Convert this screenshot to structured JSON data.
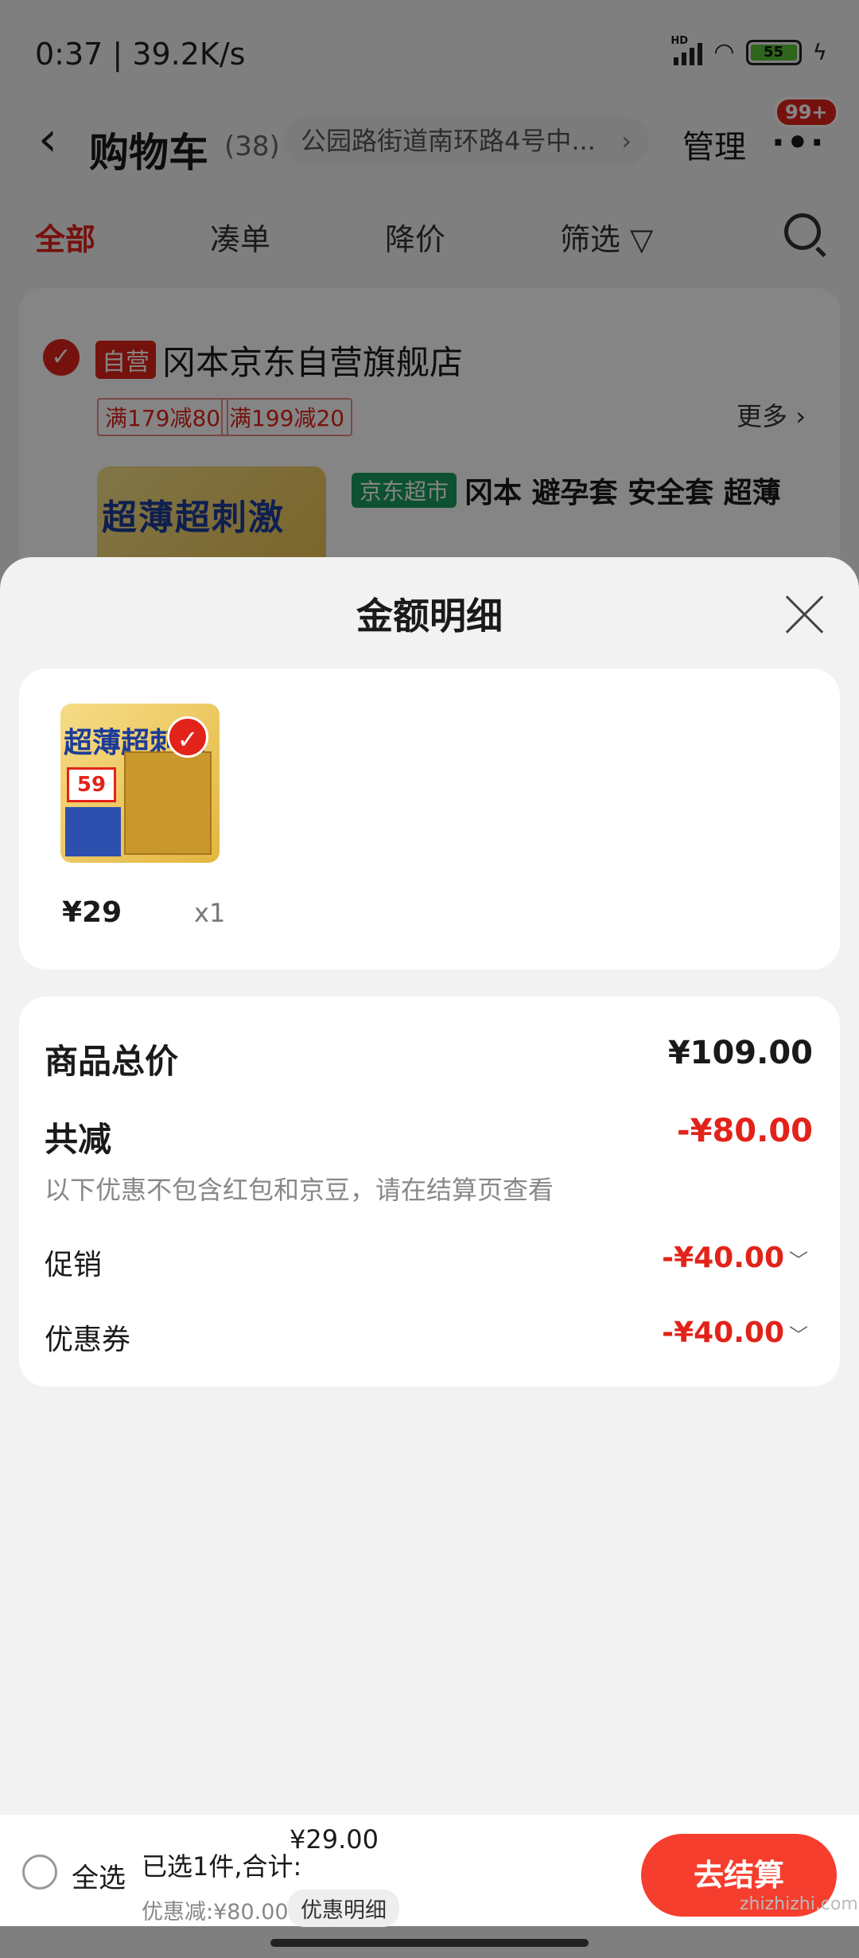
{
  "status_bar": {
    "time": "0:37 | 39.2K/s",
    "network_tag": "HD",
    "battery": "55"
  },
  "cart_header": {
    "title": "购物车",
    "count": "(38)",
    "address": "公园路街道南环路4号中...",
    "manage": "管理",
    "badge": "99+"
  },
  "filter_tabs": [
    "全部",
    "凑单",
    "降价",
    "筛选"
  ],
  "store": {
    "self_tag": "自营",
    "name": "冈本京东自营旗舰店",
    "promos": [
      "满179减80",
      "满199减20"
    ],
    "more": "更多",
    "product_tag": "京东超市",
    "product_name": "冈本 避孕套 安全套 超薄",
    "product_image_text": "超薄超刺激"
  },
  "sheet": {
    "title": "金额明细",
    "item": {
      "price": "¥29",
      "qty": "x1",
      "image_text": "超薄超刺激",
      "image_price": "59"
    },
    "summary": {
      "total_label": "商品总价",
      "total_value": "¥109.00",
      "discount_label": "共减",
      "discount_value": "-¥80.00",
      "note": "以下优惠不包含红包和京豆，请在结算页查看",
      "promo_label": "促销",
      "promo_value": "-¥40.00",
      "coupon_label": "优惠券",
      "coupon_value": "-¥40.00"
    }
  },
  "checkout": {
    "select_all": "全选",
    "selected_text": "已选1件,合计:",
    "currency": "¥",
    "total_int": "29",
    "total_dec": ".00",
    "discount_text": "优惠减:¥80.00",
    "discount_detail": "优惠明细",
    "button": "去结算"
  },
  "watermark": "zhizhizhi.com",
  "colors": {
    "accent": "#e2231a",
    "button": "#f53e2d",
    "market_green": "#1a9b5e"
  }
}
